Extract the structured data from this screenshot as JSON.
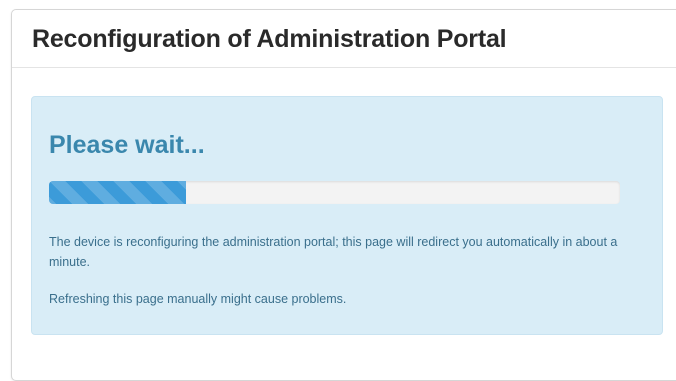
{
  "panel": {
    "title": "Reconfiguration of Administration Portal"
  },
  "alert": {
    "heading": "Please wait...",
    "progress_fraction": 0.24,
    "message": "The device is reconfiguring the administration portal; this page will redirect you automatically in about a minute.",
    "warning": "Refreshing this page manually might cause problems."
  },
  "colors": {
    "alert_background": "#d9edf7",
    "heading": "#3a87ad",
    "progress_bar": "#3c9bd9",
    "progress_track": "#f3f3f3"
  }
}
